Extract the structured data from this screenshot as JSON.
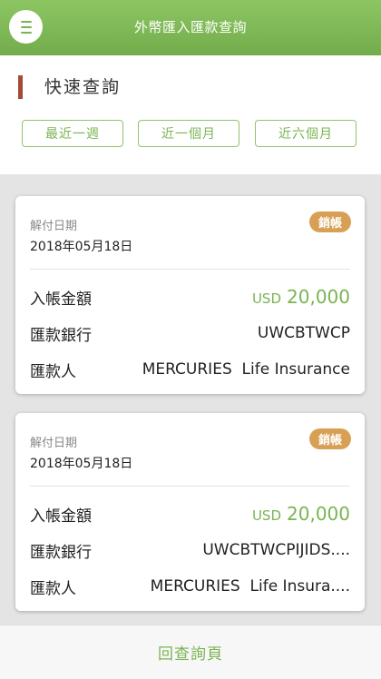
{
  "header": {
    "title": "外幣匯入匯款查詢",
    "menu_icon": "hamburger-icon"
  },
  "quick": {
    "title": "快速查詢",
    "buttons": [
      "最近一週",
      "近一個月",
      "近六個月"
    ]
  },
  "cards": [
    {
      "date_label": "解付日期",
      "date": "2018年05月18日",
      "badge": "銷帳",
      "amount_label": "入帳金額",
      "currency": "USD",
      "amount": "20,000",
      "bank_label": "匯款銀行",
      "bank": "UWCBTWCP",
      "remitter_label": "匯款人",
      "remitter": "MERCURIES  Life Insurance"
    },
    {
      "date_label": "解付日期",
      "date": "2018年05月18日",
      "badge": "銷帳",
      "amount_label": "入帳金額",
      "currency": "USD",
      "amount": "20,000",
      "bank_label": "匯款銀行",
      "bank": "UWCBTWCPIJIDS....",
      "remitter_label": "匯款人",
      "remitter": "MERCURIES  Life Insura...."
    }
  ],
  "footer": {
    "back_label": "回查詢頁"
  },
  "colors": {
    "accent": "#7ab452",
    "badge": "#d7a054",
    "marker": "#a34b34"
  }
}
